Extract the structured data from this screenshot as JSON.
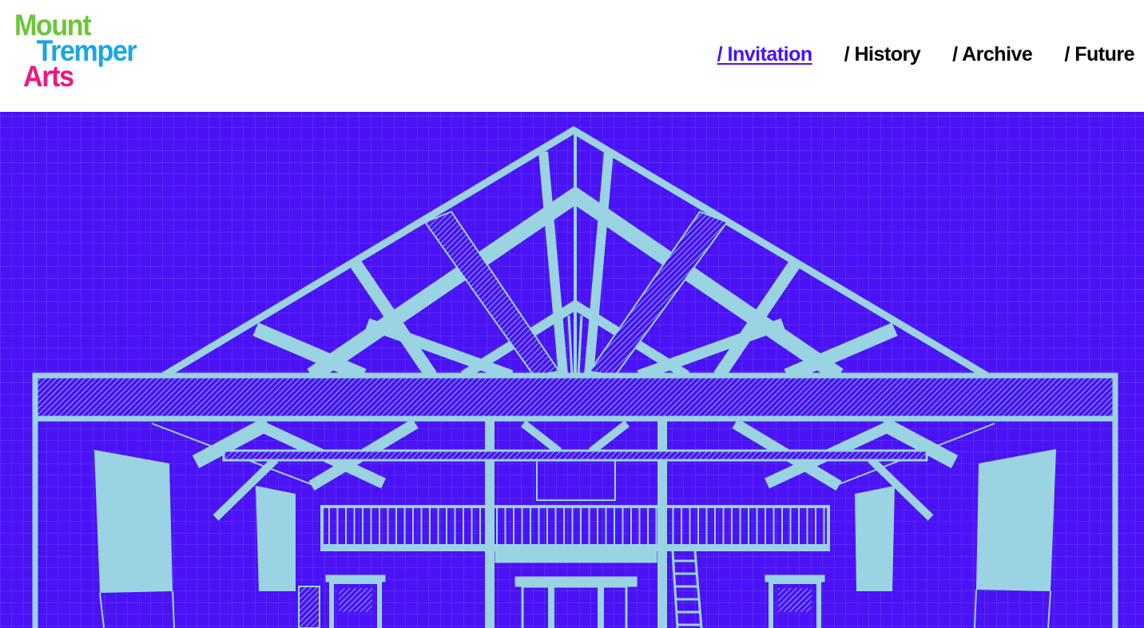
{
  "brand": {
    "line1": "Mount",
    "line2": "Tremper",
    "line3": "Arts",
    "colors": {
      "line1": "#6cc53a",
      "line2": "#17a7e3",
      "line3": "#f0157f"
    }
  },
  "nav": {
    "items": [
      {
        "label": "/ Invitation",
        "active": true
      },
      {
        "label": "/ History",
        "active": false
      },
      {
        "label": "/ Archive",
        "active": false
      },
      {
        "label": "/ Future",
        "active": false
      }
    ]
  },
  "hero": {
    "background_color": "#4a12f5",
    "line_color": "#9ad3e2"
  }
}
